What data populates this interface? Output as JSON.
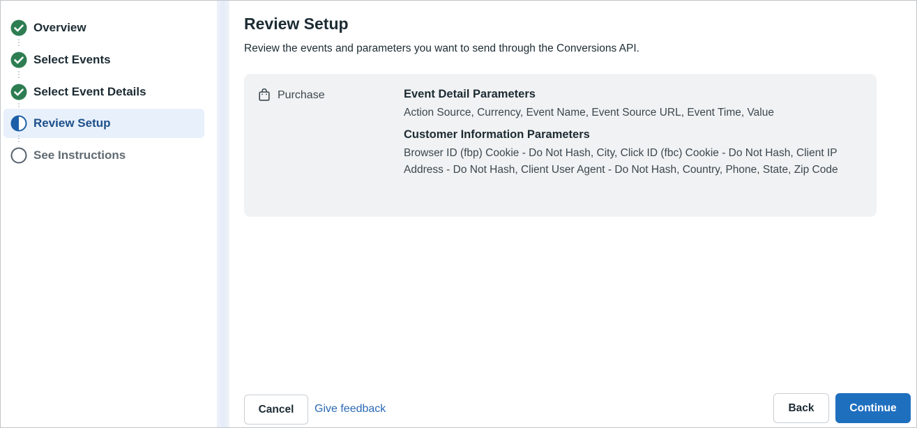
{
  "colors": {
    "complete_green": "#2e7d52",
    "active_blue": "#1d4f8a",
    "active_bg": "#e7f0fb",
    "primary_button": "#1f6fbf",
    "link": "#2a6ab5",
    "card_bg": "#f1f2f3"
  },
  "sidebar": {
    "steps": [
      {
        "label": "Overview",
        "state": "complete",
        "icon": "check-circle-icon"
      },
      {
        "label": "Select Events",
        "state": "complete",
        "icon": "check-circle-icon"
      },
      {
        "label": "Select Event Details",
        "state": "complete",
        "icon": "check-circle-icon"
      },
      {
        "label": "Review Setup",
        "state": "active",
        "icon": "half-circle-icon"
      },
      {
        "label": "See Instructions",
        "state": "pending",
        "icon": "empty-circle-icon"
      }
    ]
  },
  "main": {
    "title": "Review Setup",
    "subtitle": "Review the events and parameters you want to send through the Conversions API.",
    "event": {
      "icon": "shopping-bag-icon",
      "name": "Purchase",
      "event_detail_heading": "Event Detail Parameters",
      "event_detail_params": "Action Source, Currency, Event Name, Event Source URL, Event Time, Value",
      "customer_info_heading": "Customer Information Parameters",
      "customer_info_params": "Browser ID (fbp) Cookie - Do Not Hash, City, Click ID (fbc) Cookie - Do Not Hash, Client IP Address - Do Not Hash, Client User Agent - Do Not Hash, Country, Phone, State, Zip Code"
    }
  },
  "footer": {
    "cancel_label": "Cancel",
    "feedback_label": "Give feedback",
    "back_label": "Back",
    "continue_label": "Continue"
  }
}
